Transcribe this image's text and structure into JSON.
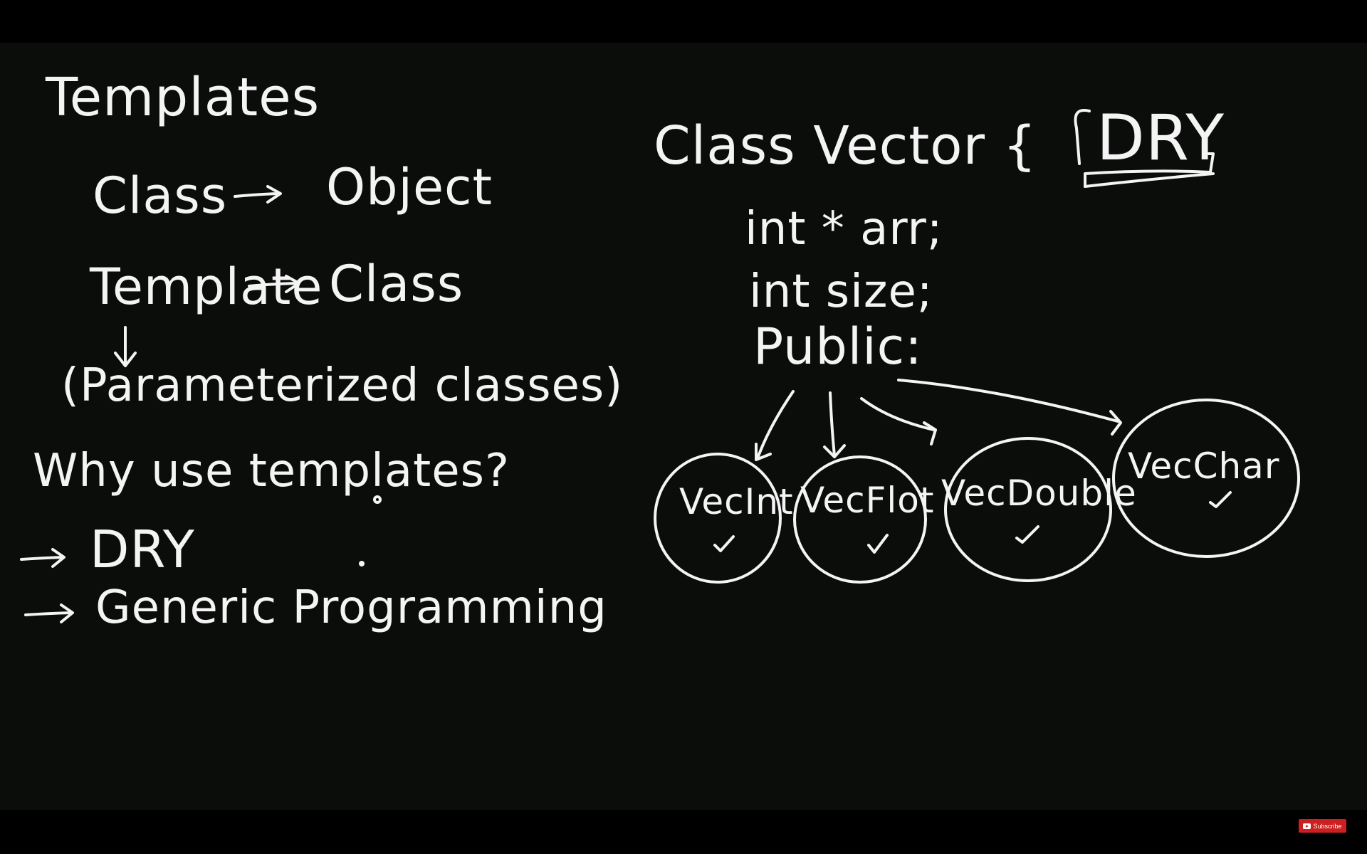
{
  "left": {
    "title": "Templates",
    "row1_left": "Class",
    "row1_right": "Object",
    "row2_left": "Template",
    "row2_right": "Class",
    "parenthetical": "(Parameterized classes)",
    "question": "Why use templates?",
    "point1": "DRY",
    "point2": "Generic Programming"
  },
  "right": {
    "class_header": "Class Vector {",
    "dry": "DRY",
    "line1": "int * arr;",
    "line2": "int size;",
    "line3": "Public:",
    "circles": [
      {
        "label": "VecInt"
      },
      {
        "label": "VecFlot"
      },
      {
        "label": "VecDouble"
      },
      {
        "label": "VecChar"
      }
    ]
  },
  "player": {
    "subscribe_label": "Subscribe"
  }
}
